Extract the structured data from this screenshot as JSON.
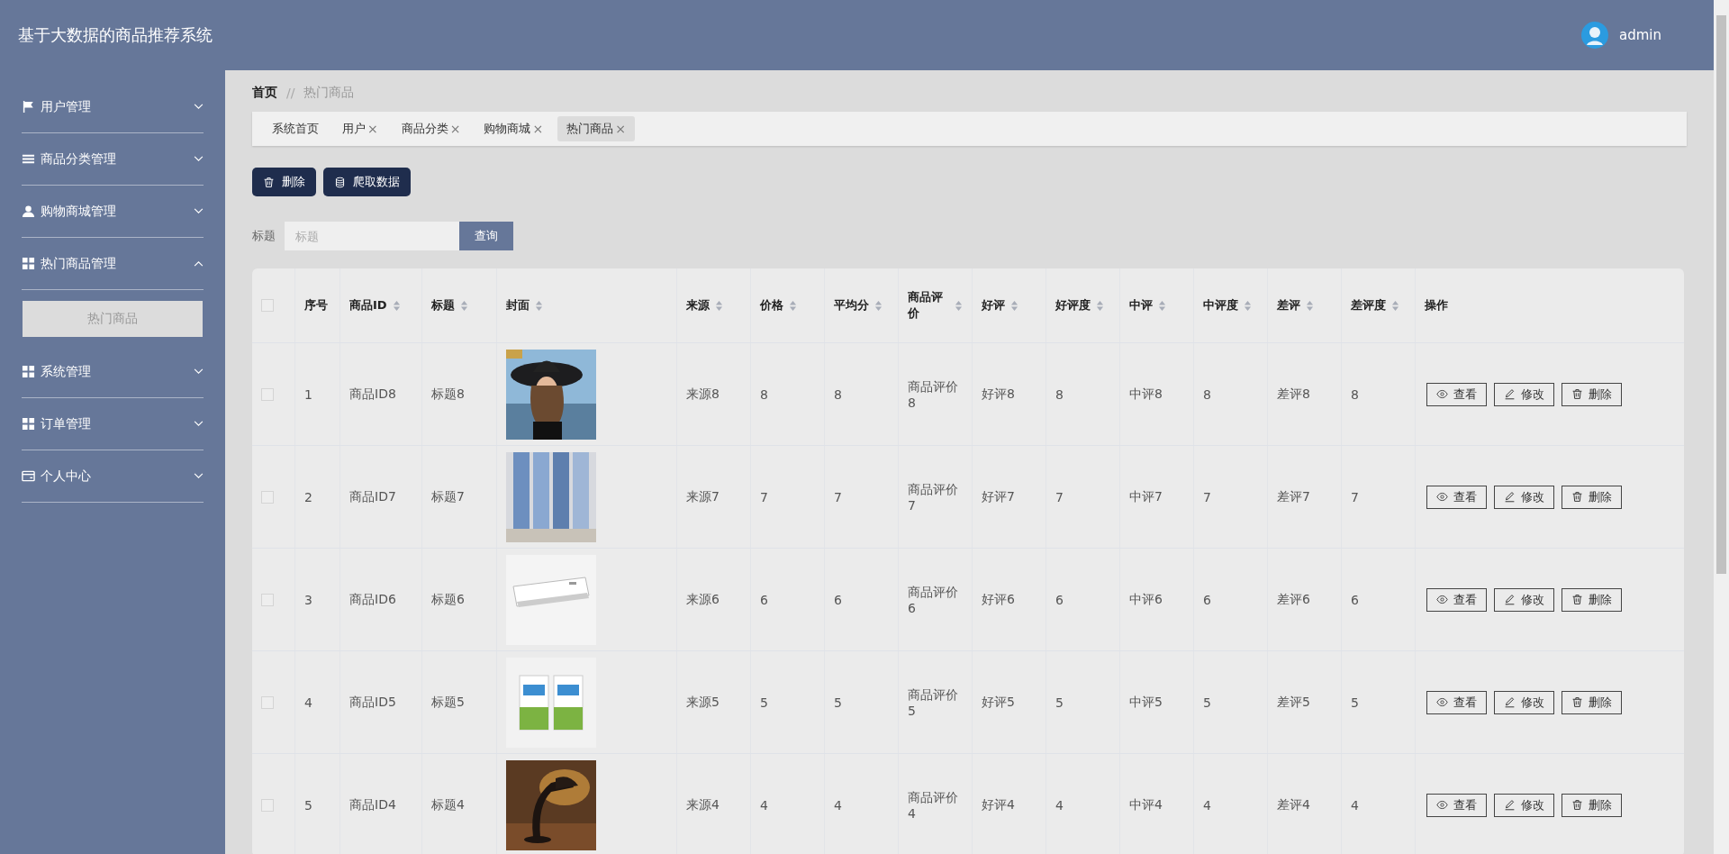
{
  "header": {
    "title": "基于大数据的商品推荐系统",
    "user": "admin"
  },
  "sidebar": {
    "items": [
      {
        "label": "用户管理",
        "expanded": false
      },
      {
        "label": "商品分类管理",
        "expanded": false
      },
      {
        "label": "购物商城管理",
        "expanded": false
      },
      {
        "label": "热门商品管理",
        "expanded": true,
        "children": [
          {
            "label": "热门商品",
            "selected": true
          }
        ]
      },
      {
        "label": "系统管理",
        "expanded": false
      },
      {
        "label": "订单管理",
        "expanded": false
      },
      {
        "label": "个人中心",
        "expanded": false
      }
    ]
  },
  "breadcrumb": [
    "首页",
    "热门商品"
  ],
  "breadcrumb_separator": "//",
  "tabs": [
    {
      "label": "系统首页",
      "closable": false,
      "selected": false
    },
    {
      "label": "用户",
      "closable": true,
      "selected": false
    },
    {
      "label": "商品分类",
      "closable": true,
      "selected": false
    },
    {
      "label": "购物商城",
      "closable": true,
      "selected": false
    },
    {
      "label": "热门商品",
      "closable": true,
      "selected": true
    }
  ],
  "tab_close": "×",
  "toolbar": [
    "删除",
    "爬取数据"
  ],
  "search": {
    "label": "标题",
    "placeholder": "标题",
    "button": "查询"
  },
  "table": {
    "header_checked": false,
    "columns": [
      {
        "label": "序号",
        "sortable": false
      },
      {
        "label": "商品ID",
        "sortable": true
      },
      {
        "label": "标题",
        "sortable": true
      },
      {
        "label": "封面",
        "sortable": true
      },
      {
        "label": "来源",
        "sortable": true
      },
      {
        "label": "价格",
        "sortable": true
      },
      {
        "label": "平均分",
        "sortable": true
      },
      {
        "label": "商品评价",
        "sortable": true
      },
      {
        "label": "好评",
        "sortable": true
      },
      {
        "label": "好评度",
        "sortable": true
      },
      {
        "label": "中评",
        "sortable": true
      },
      {
        "label": "中评度",
        "sortable": true
      },
      {
        "label": "差评",
        "sortable": true
      },
      {
        "label": "差评度",
        "sortable": true
      },
      {
        "label": "操作",
        "sortable": false
      }
    ],
    "rows": [
      {
        "checked": false,
        "cells": [
          "1",
          "商品ID8",
          "标题8",
          {
            "kind": "picture"
          },
          "来源8",
          "8",
          "8",
          "商品评价8",
          "好评8",
          "8",
          "中评8",
          "8",
          "差评8",
          "8"
        ],
        "actions": [
          "查看",
          "修改",
          "删除"
        ]
      },
      {
        "checked": false,
        "cells": [
          "2",
          "商品ID7",
          "标题7",
          {
            "kind": "picture"
          },
          "来源7",
          "7",
          "7",
          "商品评价7",
          "好评7",
          "7",
          "中评7",
          "7",
          "差评7",
          "7"
        ],
        "actions": [
          "查看",
          "修改",
          "删除"
        ]
      },
      {
        "checked": false,
        "cells": [
          "3",
          "商品ID6",
          "标题6",
          {
            "kind": "picture"
          },
          "来源6",
          "6",
          "6",
          "商品评价6",
          "好评6",
          "6",
          "中评6",
          "6",
          "差评6",
          "6"
        ],
        "actions": [
          "查看",
          "修改",
          "删除"
        ]
      },
      {
        "checked": false,
        "cells": [
          "4",
          "商品ID5",
          "标题5",
          {
            "kind": "picture"
          },
          "来源5",
          "5",
          "5",
          "商品评价5",
          "好评5",
          "5",
          "中评5",
          "5",
          "差评5",
          "5"
        ],
        "actions": [
          "查看",
          "修改",
          "删除"
        ]
      },
      {
        "checked": false,
        "cells": [
          "5",
          "商品ID4",
          "标题4",
          {
            "kind": "picture"
          },
          "来源4",
          "4",
          "4",
          "商品评价4",
          "好评4",
          "4",
          "中评4",
          "4",
          "差评4",
          "4"
        ],
        "actions": [
          "查看",
          "修改",
          "删除"
        ]
      }
    ]
  }
}
